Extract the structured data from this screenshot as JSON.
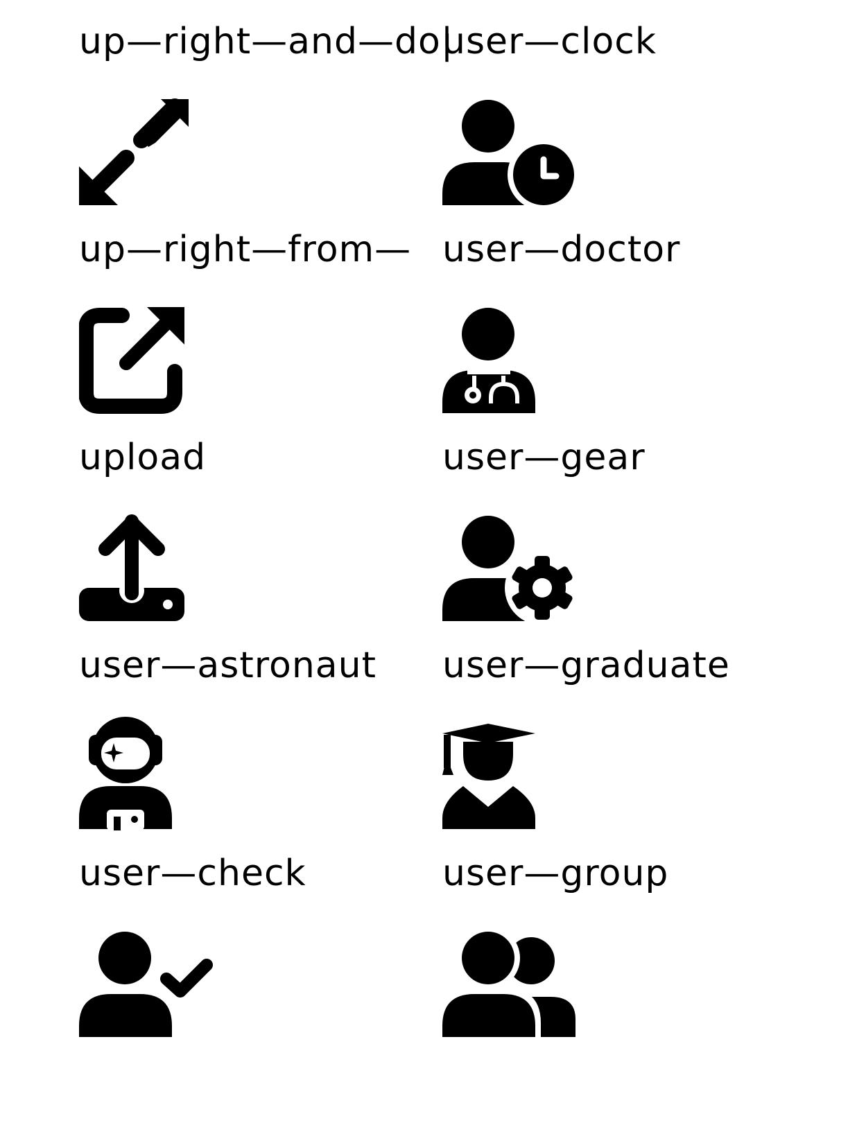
{
  "icons": [
    {
      "label": "up—right—and—do|",
      "icon": "up-right-and-down-left-icon"
    },
    {
      "label": "user—clock",
      "icon": "user-clock-icon"
    },
    {
      "label": "up—right—from—s|",
      "icon": "up-right-from-square-icon"
    },
    {
      "label": "user—doctor",
      "icon": "user-doctor-icon"
    },
    {
      "label": "upload",
      "icon": "upload-icon"
    },
    {
      "label": "user—gear",
      "icon": "user-gear-icon"
    },
    {
      "label": "user—astronaut",
      "icon": "user-astronaut-icon"
    },
    {
      "label": "user—graduate",
      "icon": "user-graduate-icon"
    },
    {
      "label": "user—check",
      "icon": "user-check-icon"
    },
    {
      "label": "user—group",
      "icon": "user-group-icon"
    }
  ],
  "colors": {
    "foreground": "#000000",
    "background": "#ffffff"
  }
}
